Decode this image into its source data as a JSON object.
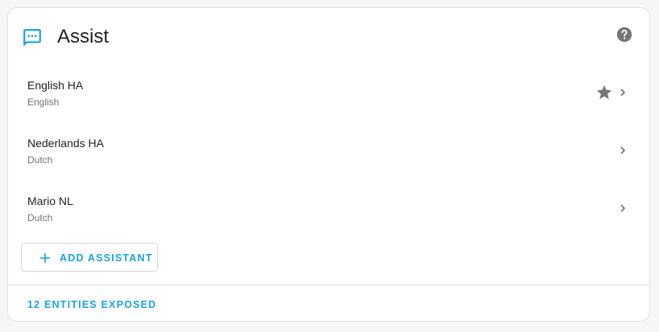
{
  "card": {
    "title": "Assist",
    "header_icon": "assist-message-icon",
    "help_icon": "help-circle-icon"
  },
  "assistants": [
    {
      "name": "English HA",
      "language": "English",
      "preferred": true
    },
    {
      "name": "Nederlands HA",
      "language": "Dutch",
      "preferred": false
    },
    {
      "name": "Mario NL",
      "language": "Dutch",
      "preferred": false
    }
  ],
  "actions": {
    "add_assistant_label": "ADD ASSISTANT",
    "exposed_entities_label": "12 ENTITIES EXPOSED"
  },
  "colors": {
    "accent": "#1aa3d9",
    "icon_gray": "#757575",
    "text_primary": "#212121",
    "text_secondary": "#727272"
  }
}
